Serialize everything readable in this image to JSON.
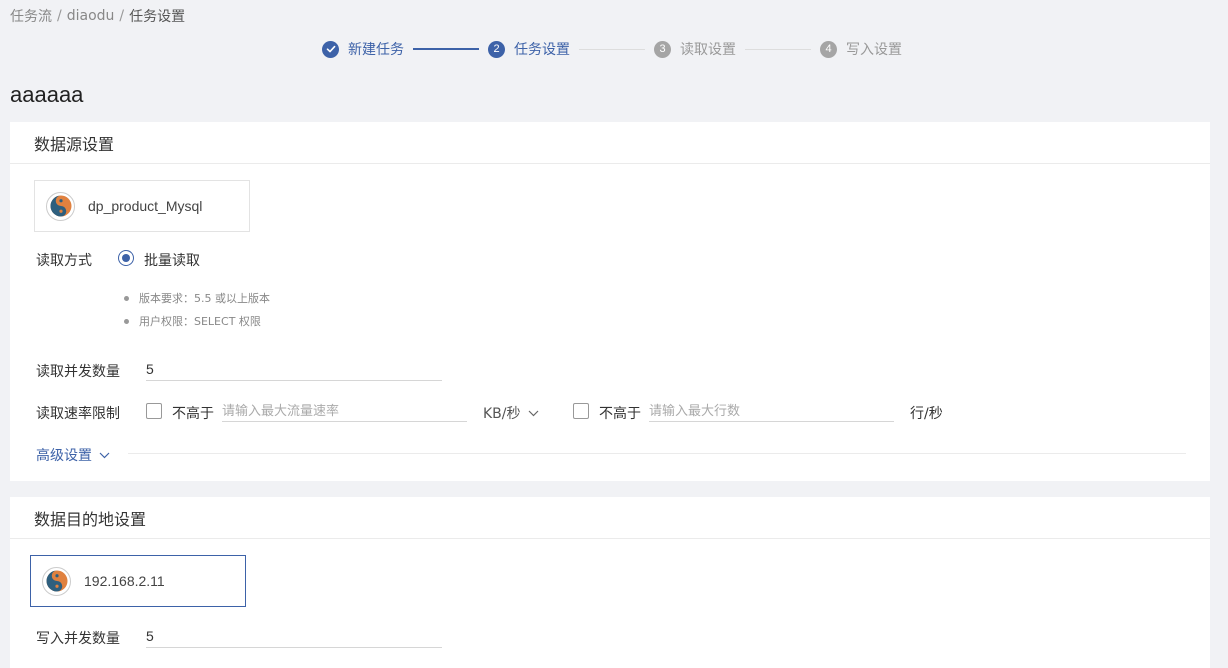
{
  "breadcrumb": {
    "items": [
      "任务流",
      "diaodu",
      "任务设置"
    ]
  },
  "steps": [
    {
      "number": "1",
      "label": "新建任务",
      "state": "done"
    },
    {
      "number": "2",
      "label": "任务设置",
      "state": "active"
    },
    {
      "number": "3",
      "label": "读取设置",
      "state": "pending"
    },
    {
      "number": "4",
      "label": "写入设置",
      "state": "pending"
    }
  ],
  "page": {
    "title": "aaaaaa"
  },
  "source": {
    "header": "数据源设置",
    "datasource_name": "dp_product_Mysql",
    "read_mode_label": "读取方式",
    "read_mode_option": "批量读取",
    "notes": [
      "版本要求：5.5 或以上版本",
      "用户权限：SELECT 权限"
    ],
    "concurrency_label": "读取并发数量",
    "concurrency_value": "5",
    "rate_label": "读取速率限制",
    "not_above_1": "不高于",
    "flow_placeholder": "请输入最大流量速率",
    "flow_unit": "KB/秒",
    "not_above_2": "不高于",
    "rows_placeholder": "请输入最大行数",
    "rows_unit": "行/秒",
    "advanced_label": "高级设置"
  },
  "target": {
    "header": "数据目的地设置",
    "datasource_name": "192.168.2.11",
    "concurrency_label": "写入并发数量",
    "concurrency_value": "5"
  },
  "colors": {
    "accent": "#3d62a8",
    "background": "#f1f2f5"
  }
}
